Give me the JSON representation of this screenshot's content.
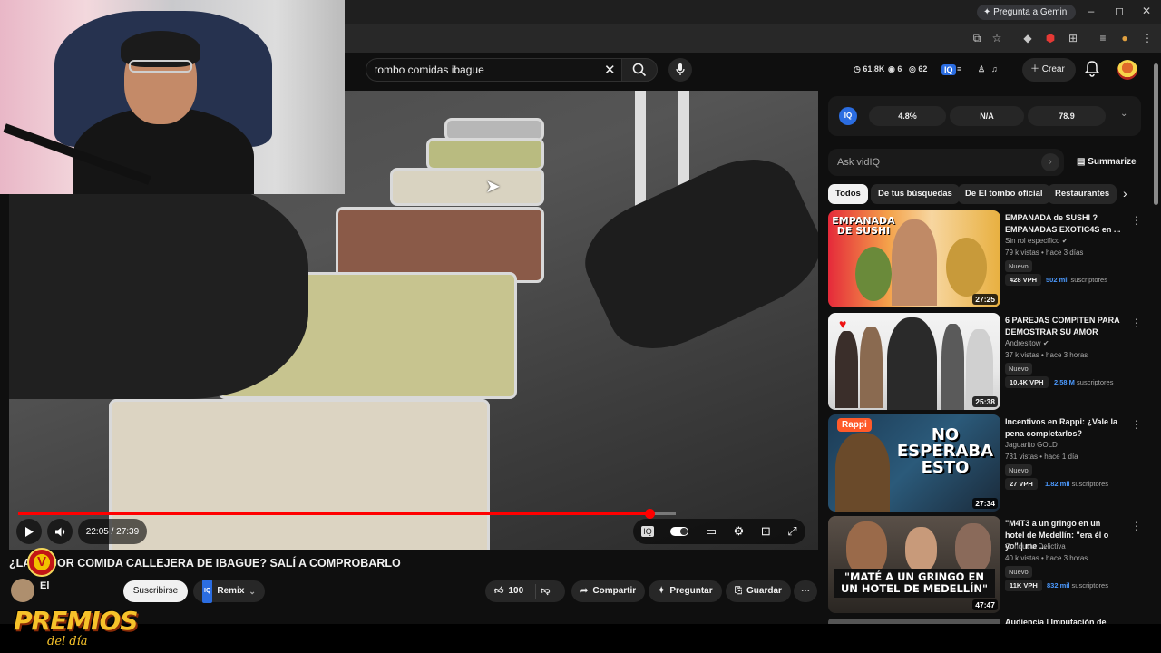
{
  "browser": {
    "gemini_label": "Pregunta a Gemini",
    "controls": [
      "–",
      "◻",
      "✕"
    ]
  },
  "header": {
    "search_value": "tombo comidas ibague",
    "stats": {
      "views": "61.8K",
      "eye": "6",
      "comments": "62"
    },
    "create_label": "Crear"
  },
  "player": {
    "time": "22:05 / 27:39",
    "progress_fraction": 0.962
  },
  "video": {
    "title": "¿LA MEJOR COMIDA CALLEJERA DE IBAGUE? SALÍ A COMPROBARLO",
    "channel_initial": "El",
    "subscribe_label": "Suscribirse",
    "remix_label": "Remix",
    "likes": "100",
    "share_label": "Compartir",
    "ask_label": "Preguntar",
    "save_label": "Guardar"
  },
  "overlay": {
    "badge": "V",
    "premios": "PREMIOS",
    "del_dia": "del día"
  },
  "vidiq": {
    "stats": [
      "4.8%",
      "N/A",
      "78.9"
    ],
    "ask_placeholder": "Ask vidIQ",
    "summarize_label": "Summarize"
  },
  "chips": [
    "Todos",
    "De tus búsquedas",
    "De El tombo oficial",
    "Restaurantes"
  ],
  "recommendations": [
    {
      "title": "EMPANADA de SUSHI ? EMPANADAS EXOTIC4S en ...",
      "channel": "Sin rol especifico",
      "meta": "79 k vistas • hace 3 días",
      "badge": "Nuevo",
      "vph": "428 VPH",
      "subs_num": "502 mil",
      "subs_label": "suscriptores",
      "duration": "27:25",
      "thumb_text": "EMPANADA DE SUSHI"
    },
    {
      "title": "6 PAREJAS COMPITEN PARA DEMOSTRAR SU AMOR",
      "channel": "Andresitow",
      "meta": "37 k vistas • hace 3 horas",
      "badge": "Nuevo",
      "vph": "10.4K VPH",
      "subs_num": "2.58 M",
      "subs_label": "suscriptores",
      "duration": "25:38",
      "thumb_text": ""
    },
    {
      "title": "Incentivos en Rappi: ¿Vale la pena completarlos?",
      "channel": "Jaguarito GOLD",
      "meta": "731 vistas • hace 1 día",
      "badge": "Nuevo",
      "vph": "27 VPH",
      "subs_num": "1.82 mil",
      "subs_label": "suscriptores",
      "duration": "27:34",
      "thumb_text": "NO ESPERABA ESTO",
      "thumb_brand": "Rappi"
    },
    {
      "title": "\"M4T3 a un gringo en un hotel de Medellín: \"era él o yo\" | me ...",
      "channel": "Conducta Delictiva",
      "meta": "40 k vistas • hace 3 horas",
      "badge": "Nuevo",
      "vph": "11K VPH",
      "subs_num": "832 mil",
      "subs_label": "suscriptores",
      "duration": "47:47",
      "thumb_text": "\"MATÉ A UN GRINGO EN UN HOTEL DE MEDELLÍN\""
    }
  ],
  "next_partial_title": "Audiencia | Imputación de"
}
